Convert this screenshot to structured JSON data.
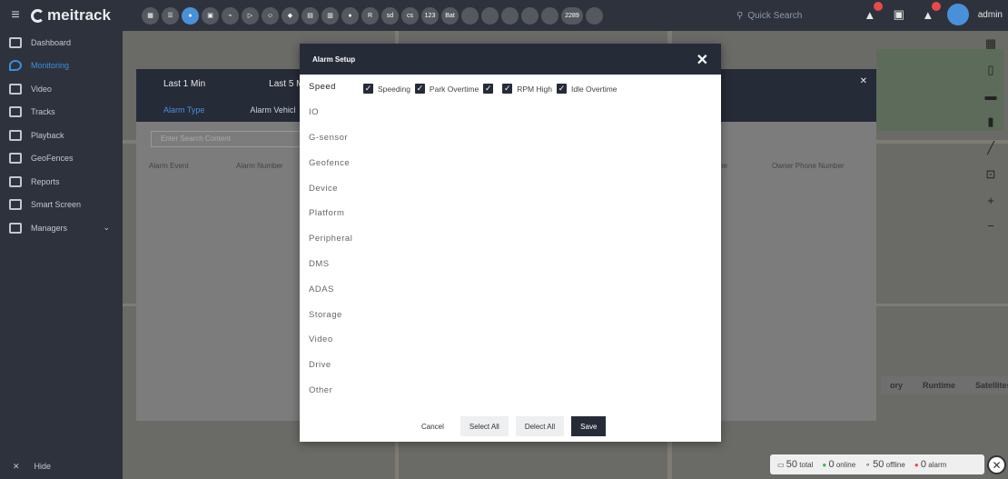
{
  "brand": {
    "name": "meitrack"
  },
  "toolbar": {
    "icons": [
      "dashboard-icon",
      "list-icon",
      "location-icon",
      "video-icon",
      "tracks-icon",
      "playback-icon",
      "user-icon",
      "car-icon",
      "card-icon",
      "signal-icon",
      "dot-icon"
    ],
    "badges": [
      "R",
      "sd",
      "cs",
      "123",
      "Bat"
    ],
    "count_badge": "2289",
    "quick_search_placeholder": "Quick Search",
    "user_name": "admin"
  },
  "sidebar": {
    "items": [
      {
        "label": "Dashboard",
        "icon": "dashboard-icon"
      },
      {
        "label": "Monitoring",
        "icon": "location-icon",
        "active": true
      },
      {
        "label": "Video",
        "icon": "video-icon"
      },
      {
        "label": "Tracks",
        "icon": "tracks-icon"
      },
      {
        "label": "Playback",
        "icon": "playback-icon"
      },
      {
        "label": "GeoFences",
        "icon": "geofence-icon"
      },
      {
        "label": "Reports",
        "icon": "reports-icon"
      },
      {
        "label": "Smart Screen",
        "icon": "screen-icon"
      },
      {
        "label": "Managers",
        "icon": "managers-icon"
      }
    ],
    "hide_label": "Hide"
  },
  "alarm_panel": {
    "search_placeholder": "Search",
    "tabs": [
      "Last 1 Min",
      "Last 5 Mi"
    ],
    "subtabs": [
      "Alarm Type",
      "Alarm Vehicl"
    ],
    "search_content_placeholder": "Enter Search Content",
    "columns": [
      "Alarm Event",
      "Alarm Number",
      "me",
      "Owner Phone Number"
    ]
  },
  "map_panel": {
    "tabs": [
      "ory",
      "Runtime",
      "Satellites"
    ]
  },
  "modal": {
    "title": "Alarm Setup",
    "categories": [
      "Speed",
      "IO",
      "G-sensor",
      "Geofence",
      "Device",
      "Platform",
      "Peripheral",
      "DMS",
      "ADAS",
      "Storage",
      "Video",
      "Drive",
      "Other"
    ],
    "active_category": "Speed",
    "options": [
      {
        "label": "Speeding",
        "checked": true
      },
      {
        "label": "Park Overtime",
        "checked": true
      },
      {
        "label": "",
        "checked": true
      },
      {
        "label": "RPM High",
        "checked": true
      },
      {
        "label": "Idle Overtime",
        "checked": true
      }
    ],
    "buttons": {
      "cancel": "Cancel",
      "select_all": "Select All",
      "deselect_all": "Delect All",
      "save": "Save"
    }
  },
  "status_bar": {
    "total": "50",
    "total_label": "total",
    "online": "0",
    "online_label": "online",
    "offline": "50",
    "offline_label": "offline",
    "alarm": "0",
    "alarm_label": "alarm"
  }
}
